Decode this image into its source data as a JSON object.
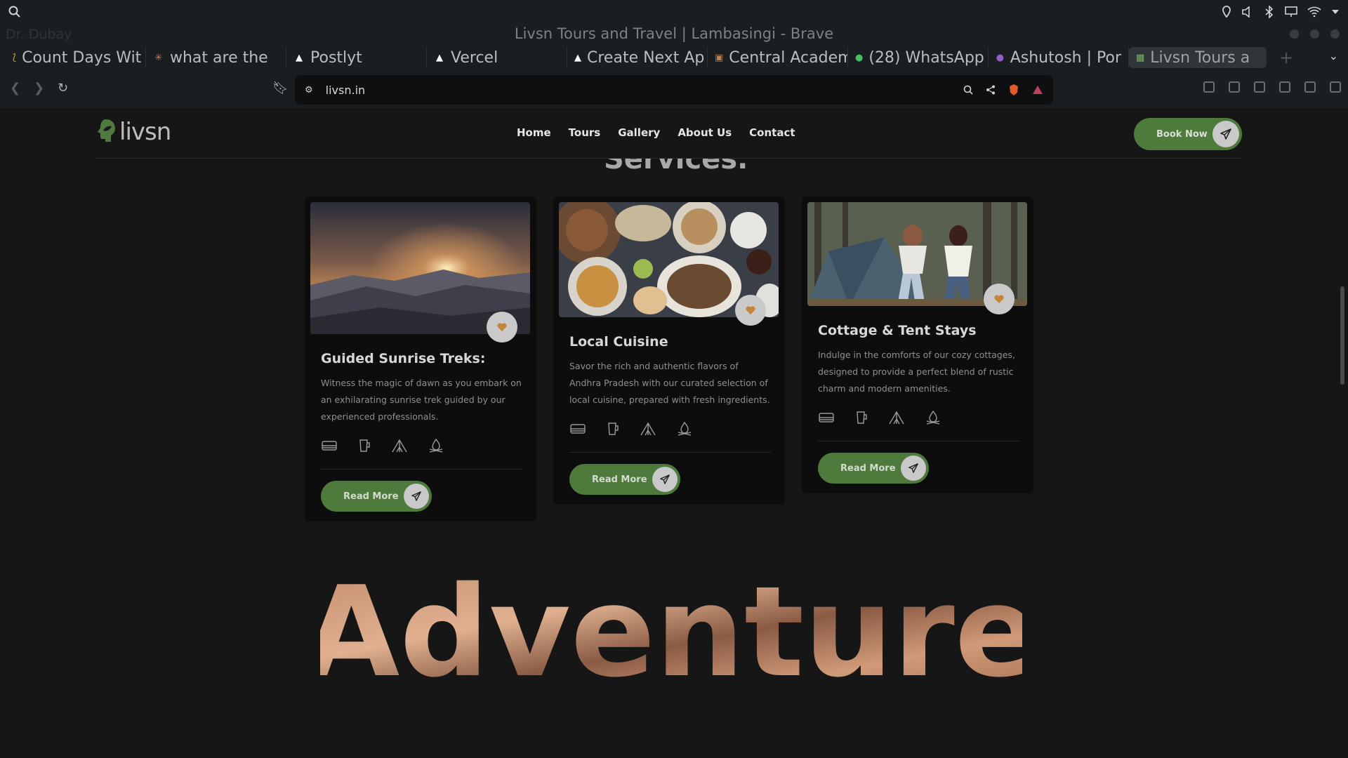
{
  "os_bar": {
    "icons": [
      "search-icon",
      "location-icon",
      "volume-icon",
      "bluetooth-icon",
      "display-icon",
      "wifi-icon",
      "chevron-down-icon"
    ]
  },
  "window": {
    "title": "Livsn Tours and Travel | Lambasingi - Brave",
    "ghost_tab": "Dr. Dubay"
  },
  "tabs": [
    {
      "label": "Count Days Wit",
      "icon": "count-days-icon"
    },
    {
      "label": "what are the",
      "icon": "chat-icon"
    },
    {
      "label": "Postlyt",
      "icon": "vercel-icon"
    },
    {
      "label": "Vercel",
      "icon": "vercel-icon"
    },
    {
      "label": "Create Next Ap",
      "icon": "vercel-icon"
    },
    {
      "label": "Central Academ",
      "icon": "school-icon"
    },
    {
      "label": "(28) WhatsApp",
      "icon": "whatsapp-icon"
    },
    {
      "label": "Ashutosh | Por",
      "icon": "portfolio-icon"
    },
    {
      "label": "Livsn Tours a",
      "icon": "livsn-icon",
      "active": true
    }
  ],
  "address_bar": {
    "url": "livsn.in"
  },
  "site": {
    "logo_text": "livsn",
    "menu": [
      "Home",
      "Tours",
      "Gallery",
      "About Us",
      "Contact"
    ],
    "book_now": "Book Now",
    "section_peek": "Services.",
    "cards": [
      {
        "title": "Guided Sunrise Treks:",
        "desc": "Witness the magic of dawn as you embark on an exhilarating sunrise trek guided by our experienced professionals.",
        "button": "Read More",
        "image": "sunrise-mountains"
      },
      {
        "title": "Local Cuisine",
        "desc": "Savor the rich and authentic flavors of Andhra Pradesh with our curated selection of local cuisine, prepared with fresh ingredients.",
        "button": "Read More",
        "image": "food-spread"
      },
      {
        "title": "Cottage & Tent Stays",
        "desc": "Indulge in the comforts of our cozy cottages, designed to provide a perfect blend of rustic charm and modern amenities.",
        "button": "Read More",
        "image": "couple-tent"
      }
    ],
    "amenity_icons": [
      "bed-icon",
      "drink-icon",
      "tent-icon",
      "campfire-icon"
    ],
    "hero_word": "Adventure"
  },
  "colors": {
    "accent_green": "#4e7a3c",
    "heart_orange": "#c8853a",
    "bg": "#161616",
    "card_bg": "#0d0d0d"
  }
}
